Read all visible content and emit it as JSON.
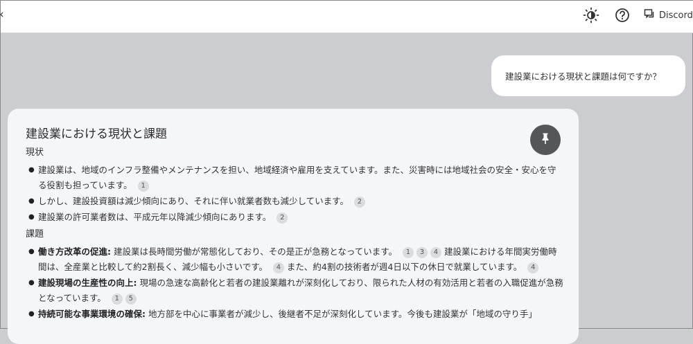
{
  "header": {
    "back": "‹",
    "discord_label": "Discord"
  },
  "icons": {
    "theme": "theme-toggle-icon",
    "help": "help-icon",
    "discord": "discord-chat-icon",
    "pin": "pin-icon"
  },
  "chat": {
    "user_question": "建設業における現状と課題は何ですか？",
    "answer": {
      "title": "建設業における現状と課題",
      "sections": [
        {
          "heading": "現状",
          "items": [
            {
              "bold": "",
              "text": "建設業は、地域のインフラ整備やメンテナンスを担い、地域経済や雇用を支えています。また、災害時には地域社会の安全・安心を守る役割も担っています。",
              "cites": [
                "1"
              ]
            },
            {
              "bold": "",
              "text": "しかし、建設投資額は減少傾向にあり、それに伴い就業者数も減少しています。",
              "cites": [
                "2"
              ]
            },
            {
              "bold": "",
              "text": "建設業の許可業者数は、平成元年以降減少傾向にあります。",
              "cites": [
                "2"
              ]
            }
          ]
        },
        {
          "heading": "課題",
          "items": [
            {
              "bold": "働き方改革の促進:",
              "text": " 建設業は長時間労働が常態化しており、その是正が急務となっています。",
              "cites": [
                "1",
                "3",
                "4"
              ],
              "text2": " 建設業における年間実労働時間は、全産業と比較して約2割長く、減少幅も小さいです。",
              "cites2": [
                "4"
              ],
              "text3": " また、約4割の技術者が週4日以下の休日で就業しています。",
              "cites3": [
                "4"
              ]
            },
            {
              "bold": "建設現場の生産性の向上:",
              "text": " 現場の急速な高齢化と若者の建設業離れが深刻化しており、限られた人材の有効活用と若者の入職促進が急務となっています。",
              "cites": [
                "1",
                "5"
              ]
            },
            {
              "bold": "持続可能な事業環境の確保:",
              "text": " 地方部を中心に事業者が減少し、後継者不足が深刻化しています。今後も建設業が「地域の守り手」",
              "cites": []
            }
          ]
        }
      ]
    }
  }
}
